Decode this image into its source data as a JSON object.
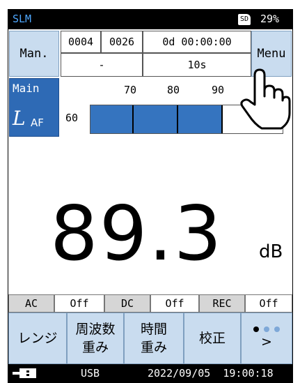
{
  "status": {
    "app": "SLM",
    "sd": "SD",
    "battery": "29%"
  },
  "mode_button": "Man.",
  "menu_button": "Menu",
  "counters": {
    "a": "0004",
    "b": "0026",
    "elapsed": "0d 00:00:00",
    "c": "-",
    "interval": "10s"
  },
  "main": {
    "label": "Main",
    "param": "L",
    "sub": "AF"
  },
  "scale": {
    "t60": "60",
    "t70": "70",
    "t80": "80",
    "t90": "90",
    "level_fraction": 0.69
  },
  "reading": {
    "value": "89.3",
    "unit": "dB"
  },
  "indicators": [
    {
      "label": "AC",
      "value": "Off"
    },
    {
      "label": "DC",
      "value": "Off"
    },
    {
      "label": "REC",
      "value": "Off"
    }
  ],
  "functions": {
    "range": "レンジ",
    "freq_1": "周波数",
    "freq_2": "重み",
    "time_1": "時間",
    "time_2": "重み",
    "calib": "校正",
    "next": ">"
  },
  "footer": {
    "usb": "USB",
    "datetime": "2022/09/05  19:00:18"
  },
  "colors": {
    "accent_blue": "#2e6ab5",
    "button_blue": "#c9dcef",
    "status_app": "#4fa8ff"
  }
}
